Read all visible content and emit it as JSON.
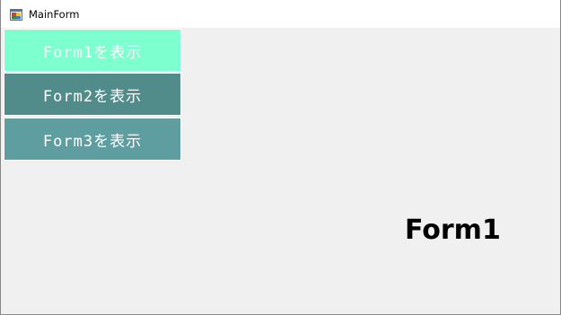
{
  "window": {
    "title": "MainForm",
    "icon": "windows-form-icon"
  },
  "nav": {
    "buttons": [
      {
        "label": "Form1を表示",
        "color": "#7dffd0"
      },
      {
        "label": "Form2を表示",
        "color": "#528c8a"
      },
      {
        "label": "Form3を表示",
        "color": "#5f9ea0"
      }
    ]
  },
  "content": {
    "label": "Form1"
  },
  "colors": {
    "client_background": "#f0f0f0",
    "button_text": "#ffffff"
  }
}
